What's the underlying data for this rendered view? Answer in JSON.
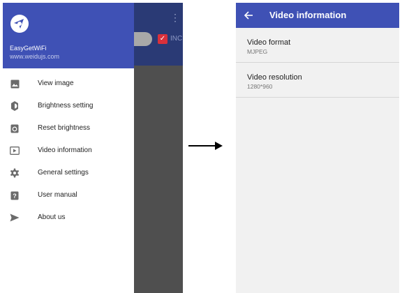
{
  "drawer": {
    "app_name": "EasyGetWiFi",
    "app_site": "www.weidujs.com",
    "items": [
      {
        "label": "View image",
        "icon": "image-icon"
      },
      {
        "label": "Brightness setting",
        "icon": "brightness-icon"
      },
      {
        "label": "Reset brightness",
        "icon": "reset-brightness-icon"
      },
      {
        "label": "Video information",
        "icon": "video-icon"
      },
      {
        "label": "General settings",
        "icon": "gear-icon"
      },
      {
        "label": "User manual",
        "icon": "help-icon"
      },
      {
        "label": "About us",
        "icon": "send-icon"
      }
    ]
  },
  "background_app": {
    "overflow_menu": "⋮",
    "checkbox_label": "INC"
  },
  "video_info": {
    "title": "Video information",
    "items": [
      {
        "label": "Video format",
        "value": "MJPEG"
      },
      {
        "label": "Video resolution",
        "value": "1280*960"
      }
    ]
  },
  "colors": {
    "primary": "#3f51b5",
    "icon_gray": "#757575",
    "accent_red": "#d9303b"
  }
}
